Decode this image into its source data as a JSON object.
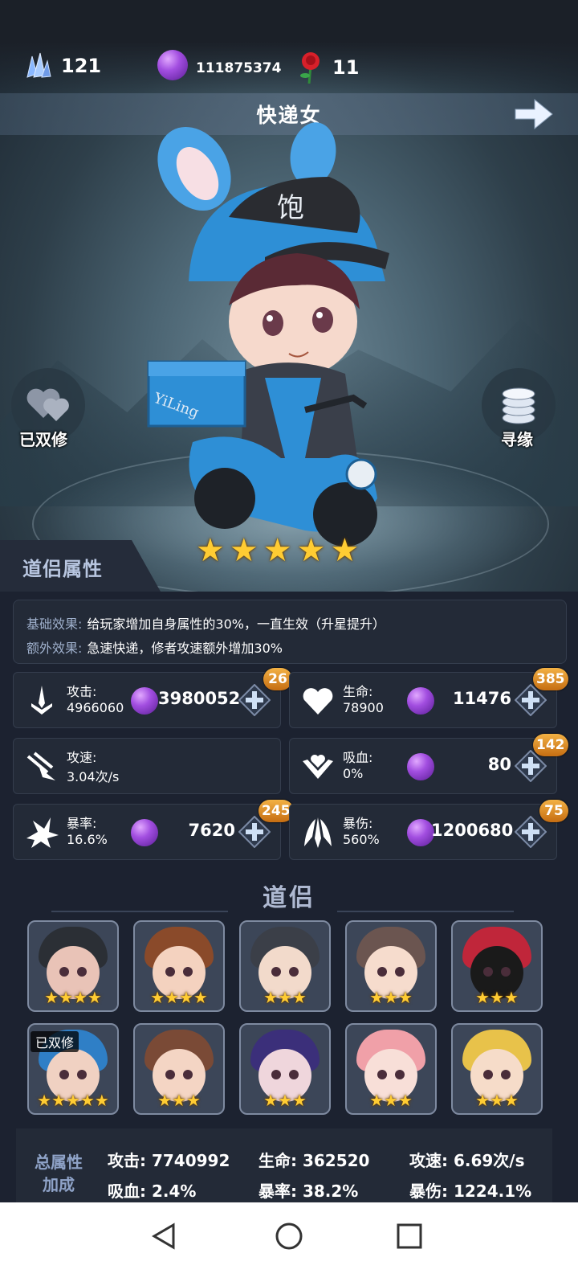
{
  "currencies": {
    "crystal": "121",
    "orb": "111875374",
    "rose": "11"
  },
  "title": "快递女",
  "side": {
    "left_label": "已双修",
    "right_label": "寻缘"
  },
  "character": {
    "cap_char": "饱",
    "box_text": "YiLing",
    "stars": 5
  },
  "section_title": "道侣属性",
  "effects": {
    "base_key": "基础效果:",
    "base_val": "给玩家增加自身属性的30%，一直生效（升星提升）",
    "extra_key": "额外效果:",
    "extra_val": "急速快递，修者攻速额外增加30%"
  },
  "stats": [
    {
      "name": "攻击:",
      "value": "4966060",
      "cost": "3980052",
      "badge": "26",
      "icon": "sword-icon"
    },
    {
      "name": "生命:",
      "value": "78900",
      "cost": "11476",
      "badge": "385",
      "icon": "heart-icon"
    },
    {
      "name": "攻速:",
      "value": "3.04次/s",
      "cost": "",
      "badge": "",
      "icon": "speed-icon"
    },
    {
      "name": "吸血:",
      "value": "0%",
      "cost": "80",
      "badge": "142",
      "icon": "lifesteal-icon"
    },
    {
      "name": "暴率:",
      "value": "16.6%",
      "cost": "7620",
      "badge": "245",
      "icon": "crit-rate-icon"
    },
    {
      "name": "暴伤:",
      "value": "560%",
      "cost": "1200680",
      "badge": "75",
      "icon": "crit-damage-icon"
    }
  ],
  "partners_title": "道侣",
  "partners": [
    {
      "stars": "★★★★",
      "tag": "",
      "hair": "#2b2f35",
      "skin": "#e9c3b7"
    },
    {
      "stars": "★★★★",
      "tag": "",
      "hair": "#8a4a2a",
      "skin": "#f4d2bf"
    },
    {
      "stars": "★★★",
      "tag": "",
      "hair": "#3b3f48",
      "skin": "#f2dacb"
    },
    {
      "stars": "★★★",
      "tag": "",
      "hair": "#6b5550",
      "skin": "#f6dccd"
    },
    {
      "stars": "★★★",
      "tag": "",
      "hair": "#c0263a",
      "skin": "#1a1a1a"
    },
    {
      "stars": "★★★★★",
      "tag": "已双修",
      "hair": "#2f7fc6",
      "skin": "#f0d1c2"
    },
    {
      "stars": "★★★",
      "tag": "",
      "hair": "#7a4a36",
      "skin": "#f4d5c4"
    },
    {
      "stars": "★★★",
      "tag": "",
      "hair": "#3b2f7a",
      "skin": "#efd6dc"
    },
    {
      "stars": "★★★",
      "tag": "",
      "hair": "#f0a0a8",
      "skin": "#f8dfd8"
    },
    {
      "stars": "★★★",
      "tag": "",
      "hair": "#e8c24a",
      "skin": "#f6dcc9"
    }
  ],
  "total": {
    "title_line1": "总属性",
    "title_line2": "加成",
    "cells": [
      "攻击: 7740992",
      "生命: 362520",
      "攻速: 6.69次/s",
      "吸血: 2.4%",
      "暴率: 38.2%",
      "暴伤: 1224.1%"
    ]
  },
  "colors": {
    "accent_gold": "#f3b144",
    "panel": "#232a37",
    "label_blue": "#9fb0cc"
  }
}
